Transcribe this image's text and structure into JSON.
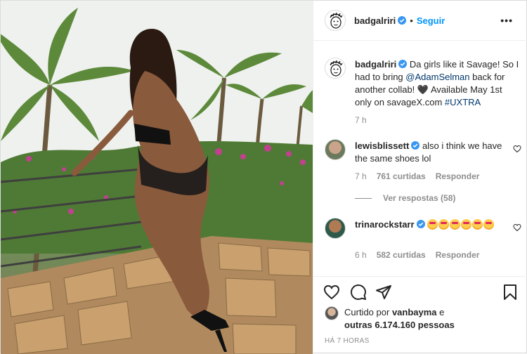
{
  "header": {
    "username": "badgalriri",
    "dot": "•",
    "follow_label": "Seguir"
  },
  "caption": {
    "username": "badgalriri",
    "text_1": "Da girls like it Savage! So I had to bring ",
    "mention": "@AdamSelman",
    "text_2": " back for another collab! 🖤 Available May 1st only on savageX.com ",
    "hashtag": "#UXTRA",
    "time": "7 h"
  },
  "comments": [
    {
      "username": "lewisblissett",
      "text": "also i think we have the same shoes lol",
      "time": "7 h",
      "likes": "761 curtidas",
      "reply_label": "Responder",
      "view_replies": "Ver respostas (58)"
    },
    {
      "username": "trinarockstarr",
      "emoji_count": 6,
      "time": "6 h",
      "likes": "582 curtidas",
      "reply_label": "Responder"
    }
  ],
  "liked_by": {
    "prefix": "Curtido por",
    "user": "vanbayma",
    "middle": "e",
    "others": "outras 6.174.160 pessoas"
  },
  "posted": "HÁ 7 HORAS",
  "icons": {
    "like": "heart-icon",
    "comment": "comment-icon",
    "share": "share-icon",
    "save": "bookmark-icon",
    "verified": "verified-badge-icon",
    "more": "more-options-icon"
  },
  "colors": {
    "accent": "#0095f6",
    "verified": "#3897f0",
    "muted": "#8e8e8e",
    "text": "#262626"
  }
}
